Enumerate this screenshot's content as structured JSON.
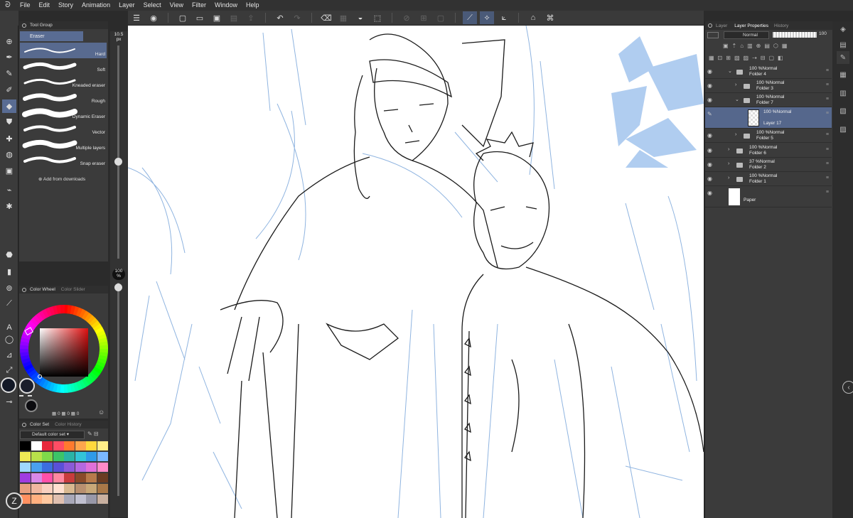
{
  "menu": [
    "File",
    "Edit",
    "Story",
    "Animation",
    "Layer",
    "Select",
    "View",
    "Filter",
    "Window",
    "Help"
  ],
  "tool_group": {
    "title": "Tool Group",
    "active": "Eraser"
  },
  "subtools": [
    {
      "label": "Hard",
      "selected": true
    },
    {
      "label": "Soft",
      "selected": false
    },
    {
      "label": "Kneaded eraser",
      "selected": false
    },
    {
      "label": "Rough",
      "selected": false
    },
    {
      "label": "Dynamic Eraser",
      "selected": false
    },
    {
      "label": "Vector",
      "selected": false
    },
    {
      "label": "Multiple layers",
      "selected": false
    },
    {
      "label": "Snap eraser",
      "selected": false
    }
  ],
  "add_from_downloads": "Add from downloads",
  "brush_size": {
    "value": "10.5",
    "unit": "px"
  },
  "opacity": {
    "value": "100",
    "unit": "%"
  },
  "color_panel": {
    "tab_active": "Color Wheel",
    "tab_other": "Color Slider",
    "values": [
      "0",
      "0",
      "0"
    ]
  },
  "color_set": {
    "tab_active": "Color Set",
    "tab_other": "Color History",
    "selected_set": "Default color set",
    "swatches": [
      "#000000",
      "#ffffff",
      "#e8283c",
      "#ff4d64",
      "#ff7a2e",
      "#ffa64d",
      "#ffd93d",
      "#ffee88",
      "#f0ea55",
      "#b8e04a",
      "#7fd84a",
      "#3cc468",
      "#2ab3a6",
      "#33c4d8",
      "#2f9ae8",
      "#7ab8ff",
      "#9fd8ff",
      "#4aa0f0",
      "#3c6ee0",
      "#5a50d8",
      "#8a5ad8",
      "#b468e0",
      "#e070d8",
      "#ff8ac8",
      "#a03ce0",
      "#d888e8",
      "#ff50a8",
      "#ff88a0",
      "#c83c3c",
      "#8a4a2a",
      "#b87a4a",
      "#6a3c22",
      "#e8a080",
      "#f0b8a0",
      "#f8d0c0",
      "#ffe0d0",
      "#d8b890",
      "#b89070",
      "#c8a878",
      "#a87848",
      "#ff9060",
      "#ffb080",
      "#ffc8a0",
      "#e0c0b0",
      "#a8a8b8",
      "#c0c0d0",
      "#9898a8",
      "#c8b0a0"
    ]
  },
  "layer_panel": {
    "tabs": [
      "Layer",
      "Layer Properties",
      "History"
    ],
    "blend_mode": "Normal",
    "opacity": "100",
    "layers": [
      {
        "pct": "100 %Normal",
        "name": "Folder 4",
        "type": "folder",
        "indent": 0,
        "open": true,
        "selected": false
      },
      {
        "pct": "100 %Normal",
        "name": "Folder 3",
        "type": "folder",
        "indent": 1,
        "open": false,
        "selected": false
      },
      {
        "pct": "100 %Normal",
        "name": "Folder 7",
        "type": "folder",
        "indent": 1,
        "open": true,
        "selected": false
      },
      {
        "pct": "100 %Normal",
        "name": "Layer 17",
        "type": "raster",
        "indent": 2,
        "open": false,
        "selected": true
      },
      {
        "pct": "100 %Normal",
        "name": "Folder 5",
        "type": "folder",
        "indent": 1,
        "open": false,
        "selected": false
      },
      {
        "pct": "100 %Normal",
        "name": "Folder 6",
        "type": "folder",
        "indent": 0,
        "open": false,
        "selected": false
      },
      {
        "pct": "37 %Normal",
        "name": "Folder 2",
        "type": "folder",
        "indent": 0,
        "open": false,
        "selected": false
      },
      {
        "pct": "100 %Normal",
        "name": "Folder 1",
        "type": "folder",
        "indent": 0,
        "open": false,
        "selected": false
      },
      {
        "pct": "",
        "name": "Paper",
        "type": "paper",
        "indent": 0,
        "open": false,
        "selected": false
      }
    ]
  },
  "colors": {
    "accent": "#596c93",
    "panel": "#3b3b3b",
    "sketch_blue": "#8fb4e0",
    "fill_blue": "#b0cdf0"
  },
  "icons": {
    "menu": "hamburger-icon",
    "tools": [
      "move-icon",
      "pen-icon",
      "pencil-icon",
      "brush-icon",
      "eraser-icon",
      "fill-icon",
      "gradient-icon",
      "blend-icon",
      "figure-icon",
      "selection-icon",
      "auto-select-icon",
      "eyedropper-icon",
      "text-icon",
      "balloon-icon",
      "frame-icon",
      "ruler-icon",
      "hand-icon",
      "color-picker-icon"
    ]
  }
}
